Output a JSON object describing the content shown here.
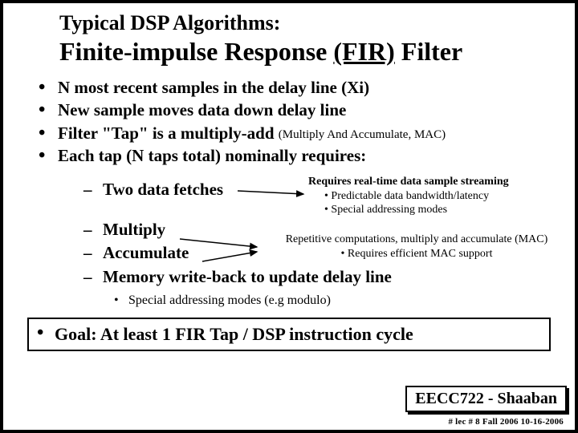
{
  "header": {
    "subtitle": "Typical DSP Algorithms:",
    "title_a": "Finite-impulse Response ",
    "title_b": "(FIR)",
    "title_c": " Filter"
  },
  "bullets": {
    "b1": "N most recent samples in the delay line (Xi)",
    "b2": "New sample moves data down delay line",
    "b3": "Filter \"Tap\" is a multiply-add",
    "b3_note": "(Multiply And Accumulate, MAC)",
    "b4": "Each tap (N taps total) nominally requires:"
  },
  "sub": {
    "s1": "Two data fetches",
    "s2": "Multiply",
    "s3": "Accumulate",
    "s4": "Memory write-back to update delay line",
    "s4_note": "Special addressing modes (e.g modulo)"
  },
  "notes": {
    "stream_title": "Requires real-time data sample streaming",
    "stream_a": "Predictable data bandwidth/latency",
    "stream_b": "Special addressing modes",
    "mac_title": "Repetitive computations, multiply and accumulate (MAC)",
    "mac_a": "Requires efficient MAC support"
  },
  "goal": {
    "text": "Goal:  At least 1 FIR Tap / DSP instruction cycle"
  },
  "footer": {
    "course": "EECC722 - Shaaban",
    "meta": "#  lec # 8    Fall 2006    10-16-2006"
  }
}
